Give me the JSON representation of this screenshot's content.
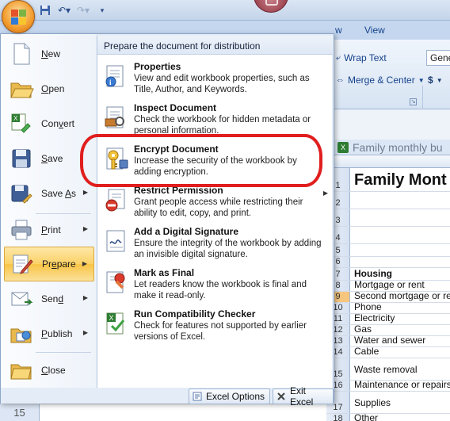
{
  "ribbon": {
    "tabs": [
      "w",
      "View"
    ],
    "wrap_text": "Wrap Text",
    "merge_center": "Merge & Center",
    "number_format": "Gene",
    "currency": "$"
  },
  "sheet": {
    "window_title": "Family monthly bu",
    "rows": [
      {
        "num": "1",
        "text": "Family Mont",
        "style": "title"
      },
      {
        "num": "2",
        "text": ""
      },
      {
        "num": "3",
        "text": ""
      },
      {
        "num": "4",
        "text": ""
      },
      {
        "num": "5",
        "text": ""
      },
      {
        "num": "6",
        "text": ""
      },
      {
        "num": "7",
        "text": "Housing",
        "style": "bold"
      },
      {
        "num": "8",
        "text": "Mortgage or rent"
      },
      {
        "num": "9",
        "text": "Second mortgage or rent",
        "selected": true
      },
      {
        "num": "10",
        "text": "Phone"
      },
      {
        "num": "11",
        "text": "Electricity"
      },
      {
        "num": "12",
        "text": "Gas"
      },
      {
        "num": "13",
        "text": "Water and sewer"
      },
      {
        "num": "14",
        "text": "Cable"
      },
      {
        "num": "15",
        "text": "Waste removal"
      },
      {
        "num": "16",
        "text": "Maintenance or repairs"
      },
      {
        "num": "17",
        "text": "Supplies"
      },
      {
        "num": "18",
        "text": "Other"
      }
    ],
    "bottom_left_row": "15"
  },
  "menu": {
    "items": [
      {
        "key": "N",
        "rest": "ew",
        "icon": "new-document-icon"
      },
      {
        "key": "O",
        "rest": "pen",
        "icon": "open-folder-icon"
      },
      {
        "pre": "Con",
        "key": "v",
        "rest": "ert",
        "icon": "convert-icon"
      },
      {
        "key": "S",
        "rest": "ave",
        "icon": "save-icon"
      },
      {
        "pre": "Save ",
        "key": "A",
        "rest": "s",
        "icon": "save-as-icon"
      },
      {
        "key": "P",
        "rest": "rint",
        "icon": "print-icon"
      },
      {
        "pre": "Pr",
        "key": "e",
        "rest": "pare",
        "icon": "prepare-icon"
      },
      {
        "pre": "Sen",
        "key": "d",
        "rest": "",
        "icon": "send-icon"
      },
      {
        "key": "P",
        "rest": "ublish",
        "icon": "publish-icon"
      },
      {
        "key": "C",
        "rest": "lose",
        "icon": "close-icon"
      }
    ],
    "submenu": {
      "header": "Prepare the document for distribution",
      "items": [
        {
          "title": "Properties",
          "desc": "View and edit workbook properties, such as Title, Author, and Keywords."
        },
        {
          "title": "Inspect Document",
          "desc": "Check the workbook for hidden metadata or personal information."
        },
        {
          "title": "Encrypt Document",
          "desc": "Increase the security of the workbook by adding encryption."
        },
        {
          "title": "Restrict Permission",
          "desc": "Grant people access while restricting their ability to edit, copy, and print."
        },
        {
          "title": "Add a Digital Signature",
          "desc": "Ensure the integrity of the workbook by adding an invisible digital signature."
        },
        {
          "title": "Mark as Final",
          "desc": "Let readers know the workbook is final and make it read-only."
        },
        {
          "title": "Run Compatibility Checker",
          "desc": "Check for features not supported by earlier versions of Excel."
        }
      ]
    },
    "excel_options": "Excel Options",
    "exit_excel": "Exit Excel"
  },
  "colors": {
    "highlight": "#e01e1e",
    "active_item": "#fbd266",
    "selected_row": "#f7c67e"
  }
}
